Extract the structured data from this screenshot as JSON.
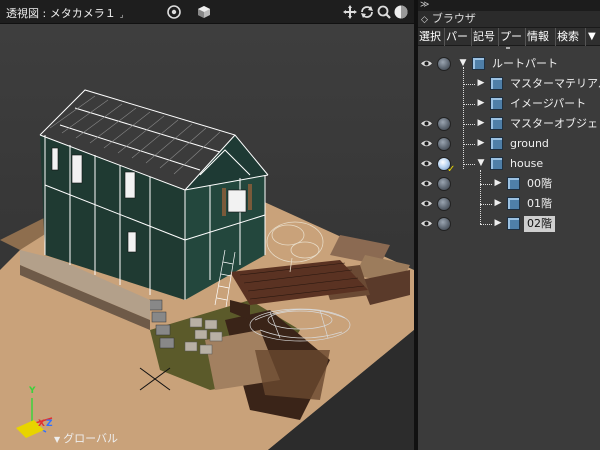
{
  "viewport": {
    "title": "透視図 : メタカメラ１",
    "title_caret": "⌟",
    "icons": [
      "target-icon",
      "cube-icon",
      "move-icon",
      "rotate-icon",
      "zoom-icon",
      "shading-icon"
    ],
    "axis_labels": {
      "x": "X",
      "y": "Y",
      "z": "Z"
    },
    "coordinate_mode": "グローバル",
    "coordinate_caret": "▼"
  },
  "panel": {
    "top_glyph": "≫",
    "title_glyph": "◇",
    "title": "ブラウザ",
    "tabs": [
      "選択",
      "パー",
      "記号",
      "プー",
      "情報",
      "検索"
    ],
    "menu_glyph": "▼"
  },
  "tree": [
    {
      "label": "ルートパート",
      "eye": true,
      "dot": true,
      "active": false,
      "check": false,
      "arrow": "▼",
      "level": 0,
      "selected": false
    },
    {
      "label": "マスターマテリアル",
      "eye": false,
      "dot": false,
      "active": false,
      "check": false,
      "arrow": "▶",
      "level": 1,
      "selected": false
    },
    {
      "label": "イメージパート",
      "eye": false,
      "dot": false,
      "active": false,
      "check": false,
      "arrow": "▶",
      "level": 1,
      "selected": false
    },
    {
      "label": "マスターオブジェ",
      "eye": true,
      "dot": true,
      "active": false,
      "check": false,
      "arrow": "▶",
      "level": 1,
      "selected": false
    },
    {
      "label": "ground",
      "eye": true,
      "dot": true,
      "active": false,
      "check": false,
      "arrow": "▶",
      "level": 1,
      "selected": false
    },
    {
      "label": "house",
      "eye": true,
      "dot": true,
      "active": true,
      "check": true,
      "arrow": "▼",
      "level": 1,
      "selected": false
    },
    {
      "label": "00階",
      "eye": true,
      "dot": true,
      "active": false,
      "check": false,
      "arrow": "▶",
      "level": 2,
      "selected": false
    },
    {
      "label": "01階",
      "eye": true,
      "dot": true,
      "active": false,
      "check": false,
      "arrow": "▶",
      "level": 2,
      "selected": false
    },
    {
      "label": "02階",
      "eye": true,
      "dot": true,
      "active": false,
      "check": false,
      "arrow": "▶",
      "level": 2,
      "selected": true
    }
  ],
  "check_glyph": "✓",
  "colors": {
    "ground": "#c9a27a",
    "house_wall": "#1f3a32",
    "roof": "#3b3b3b",
    "wireframe": "#ffffff",
    "grass": "#5b5a2a",
    "selected_row": "#cfcfcf"
  }
}
